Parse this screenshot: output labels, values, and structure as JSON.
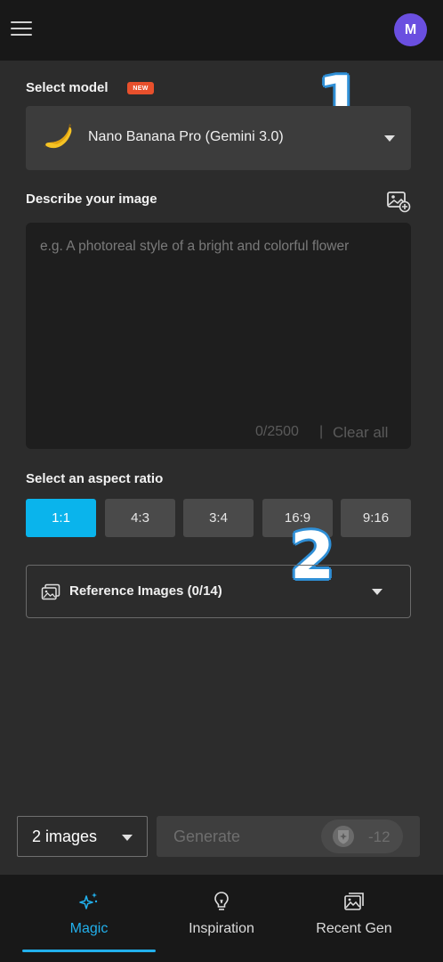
{
  "header": {
    "menu_icon": "hamburger-menu-icon",
    "avatar_initial": "M",
    "avatar_color": "#6a4fe0"
  },
  "annotations": [
    "1",
    "2"
  ],
  "model": {
    "label": "Select model",
    "badge": "NEW",
    "selected": "Nano Banana Pro (Gemini 3.0)",
    "icon": "banana-icon"
  },
  "prompt": {
    "label": "Describe your image",
    "placeholder": "e.g. A photoreal style of a bright and colorful flower",
    "value": "",
    "counter": "0/2500",
    "separator": "|",
    "clear_label": "Clear all",
    "add_image_icon": "image-add-icon"
  },
  "aspect": {
    "label": "Select an aspect ratio",
    "options": [
      "1:1",
      "4:3",
      "3:4",
      "16:9",
      "9:16"
    ],
    "selected": "1:1",
    "accent": "#0ab4ec"
  },
  "reference": {
    "label": "Reference Images (0/14)",
    "icon": "images-icon"
  },
  "footer": {
    "count_label": "2 images",
    "generate_label": "Generate",
    "cost": "-12",
    "cost_icon": "credit-coin-icon"
  },
  "nav": {
    "items": [
      {
        "label": "Magic",
        "icon": "sparkle-icon",
        "active": true
      },
      {
        "label": "Inspiration",
        "icon": "lightbulb-icon",
        "active": false
      },
      {
        "label": "Recent Gen",
        "icon": "gallery-icon",
        "active": false
      }
    ],
    "accent": "#22b0ec"
  }
}
